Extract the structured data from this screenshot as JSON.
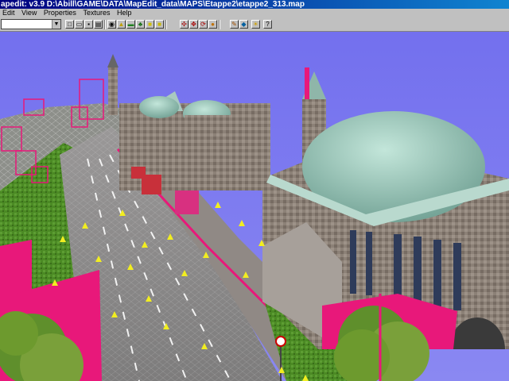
{
  "window": {
    "title": "apedit: v3.9  D:\\Abill\\GAME\\DATA\\MapEdit_data\\MAPS\\Etappe2\\etappe2_313.map"
  },
  "menu": {
    "items": [
      "Edit",
      "View",
      "Properties",
      "Textures",
      "Help"
    ]
  },
  "toolbar": {
    "combo_value": "",
    "buttons": [
      "new-icon",
      "open-icon",
      "save-icon",
      "copy-icon",
      "view-icon",
      "cone-icon",
      "grass-icon",
      "tree-icon",
      "cube-icon",
      "texture-icon",
      "split-icon",
      "arrows-icon",
      "rotate-icon",
      "bulb-icon",
      "pencil-icon",
      "palette-icon",
      "sun-icon",
      "help-icon"
    ]
  },
  "colors": {
    "sky": "#7b78ee",
    "road": "#8d8c8c",
    "pink": "#e8187a",
    "grass": "#4b8a24",
    "dome": "#9fcfbe",
    "stone": "#8a8078"
  }
}
